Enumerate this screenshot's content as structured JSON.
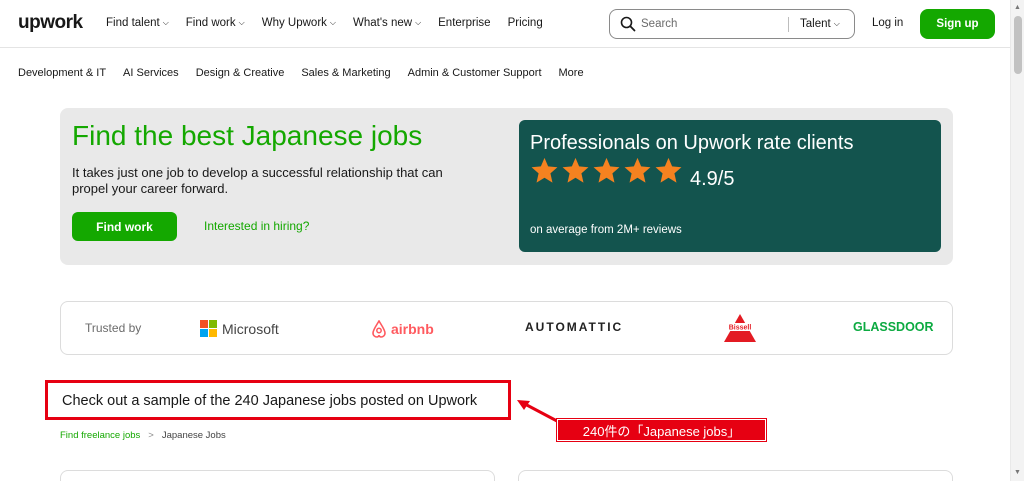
{
  "header": {
    "logo": "upwork",
    "nav": [
      {
        "label": "Find talent",
        "dropdown": true
      },
      {
        "label": "Find work",
        "dropdown": true
      },
      {
        "label": "Why Upwork",
        "dropdown": true
      },
      {
        "label": "What's new",
        "dropdown": true
      },
      {
        "label": "Enterprise",
        "dropdown": false
      },
      {
        "label": "Pricing",
        "dropdown": false
      }
    ],
    "search_placeholder": "Search",
    "search_scope": "Talent",
    "login": "Log in",
    "signup": "Sign up"
  },
  "categories": [
    "Development & IT",
    "AI Services",
    "Design & Creative",
    "Sales & Marketing",
    "Admin & Customer Support",
    "More"
  ],
  "hero": {
    "title": "Find the best Japanese jobs",
    "description": "It takes just one job to develop a successful relationship that can propel your career forward.",
    "find_work": "Find work",
    "hiring_link": "Interested in hiring?",
    "rating_card": {
      "title": "Professionals on Upwork rate clients",
      "rating": "4.9/5",
      "stars": 5,
      "reviews": "on average from 2M+ reviews",
      "bg_color": "#13544e",
      "star_color": "#f58220"
    }
  },
  "trusted": {
    "label": "Trusted by",
    "brands": [
      "Microsoft",
      "airbnb",
      "AUTOMATTIC",
      "Bissell",
      "GLASSDOOR"
    ]
  },
  "sample": {
    "title": "Check out a sample of the 240 Japanese jobs posted on Upwork",
    "annotation": "240件の「Japanese jobs」"
  },
  "breadcrumb": {
    "link": "Find freelance jobs",
    "separator": ">",
    "current": "Japanese Jobs"
  },
  "colors": {
    "brand_green": "#14a800",
    "annotation_red": "#e60012"
  }
}
